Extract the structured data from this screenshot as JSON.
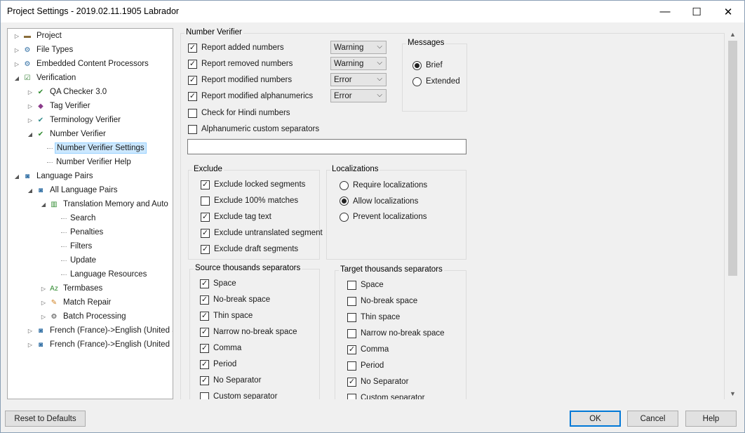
{
  "window": {
    "title": "Project Settings - 2019.02.11.1905 Labrador",
    "minimize": "—",
    "maximize": "☐",
    "close": "✕"
  },
  "tree": [
    {
      "label": "Project",
      "icon": "project-icon"
    },
    {
      "label": "File Types",
      "icon": "file-types-icon"
    },
    {
      "label": "Embedded Content Processors",
      "icon": "embedded-content-icon"
    },
    {
      "label": "Verification",
      "icon": "verification-icon"
    },
    {
      "label": "QA Checker 3.0",
      "icon": "qa-checker-icon"
    },
    {
      "label": "Tag Verifier",
      "icon": "tag-verifier-icon"
    },
    {
      "label": "Terminology Verifier",
      "icon": "terminology-verifier-icon"
    },
    {
      "label": "Number Verifier",
      "icon": "number-verifier-icon"
    },
    {
      "label": "Number Verifier Settings",
      "icon": ""
    },
    {
      "label": "Number Verifier Help",
      "icon": ""
    },
    {
      "label": "Language Pairs",
      "icon": "language-pairs-icon"
    },
    {
      "label": "All Language Pairs",
      "icon": "language-pairs-icon"
    },
    {
      "label": "Translation Memory and Auto",
      "icon": "translation-memory-icon"
    },
    {
      "label": "Search",
      "icon": ""
    },
    {
      "label": "Penalties",
      "icon": ""
    },
    {
      "label": "Filters",
      "icon": ""
    },
    {
      "label": "Update",
      "icon": ""
    },
    {
      "label": "Language Resources",
      "icon": ""
    },
    {
      "label": "Termbases",
      "icon": "termbases-icon"
    },
    {
      "label": "Match Repair",
      "icon": "match-repair-icon"
    },
    {
      "label": "Batch Processing",
      "icon": "batch-processing-icon"
    },
    {
      "label": "French (France)->English (United S",
      "icon": "language-pair-icon"
    },
    {
      "label": "French (France)->English (United",
      "icon": "language-pair-icon"
    }
  ],
  "main": {
    "section_title": "Number Verifier",
    "reports": [
      {
        "label": "Report added numbers",
        "checked": true,
        "severity": "Warning"
      },
      {
        "label": "Report removed numbers",
        "checked": true,
        "severity": "Warning"
      },
      {
        "label": "Report modified numbers",
        "checked": true,
        "severity": "Error"
      },
      {
        "label": "Report modified alphanumerics",
        "checked": true,
        "severity": "Error"
      },
      {
        "label": "Check for Hindi numbers",
        "checked": false
      },
      {
        "label": "Alphanumeric custom separators",
        "checked": false
      }
    ],
    "messages": {
      "title": "Messages",
      "options": [
        {
          "label": "Brief",
          "selected": true
        },
        {
          "label": "Extended",
          "selected": false
        }
      ]
    },
    "exclude": {
      "title": "Exclude",
      "items": [
        {
          "label": "Exclude locked segments",
          "checked": true
        },
        {
          "label": "Exclude 100% matches",
          "checked": false
        },
        {
          "label": "Exclude tag text",
          "checked": true
        },
        {
          "label": "Exclude untranslated segment",
          "checked": true
        },
        {
          "label": "Exclude draft segments",
          "checked": true
        }
      ]
    },
    "localizations": {
      "title": "Localizations",
      "options": [
        {
          "label": "Require localizations",
          "selected": false
        },
        {
          "label": "Allow localizations",
          "selected": true
        },
        {
          "label": "Prevent localizations",
          "selected": false
        }
      ]
    },
    "source_sep": {
      "title": "Source thousands separators",
      "items": [
        {
          "label": "Space",
          "checked": true
        },
        {
          "label": "No-break space",
          "checked": true
        },
        {
          "label": "Thin space",
          "checked": true
        },
        {
          "label": "Narrow no-break space",
          "checked": true
        },
        {
          "label": "Comma",
          "checked": true
        },
        {
          "label": "Period",
          "checked": true
        },
        {
          "label": "No Separator",
          "checked": true
        },
        {
          "label": "Custom separator",
          "checked": false
        }
      ]
    },
    "target_sep": {
      "title": "Target thousands separators",
      "items": [
        {
          "label": "Space",
          "checked": false
        },
        {
          "label": "No-break space",
          "checked": false
        },
        {
          "label": "Thin space",
          "checked": false
        },
        {
          "label": "Narrow no-break space",
          "checked": false
        },
        {
          "label": "Comma",
          "checked": true
        },
        {
          "label": "Period",
          "checked": false
        },
        {
          "label": "No Separator",
          "checked": true
        },
        {
          "label": "Custom separator",
          "checked": false
        }
      ]
    }
  },
  "footer": {
    "reset": "Reset to Defaults",
    "ok": "OK",
    "cancel": "Cancel",
    "help": "Help"
  },
  "colors": {
    "selection": "#cce8ff",
    "accent": "#0078d7"
  }
}
